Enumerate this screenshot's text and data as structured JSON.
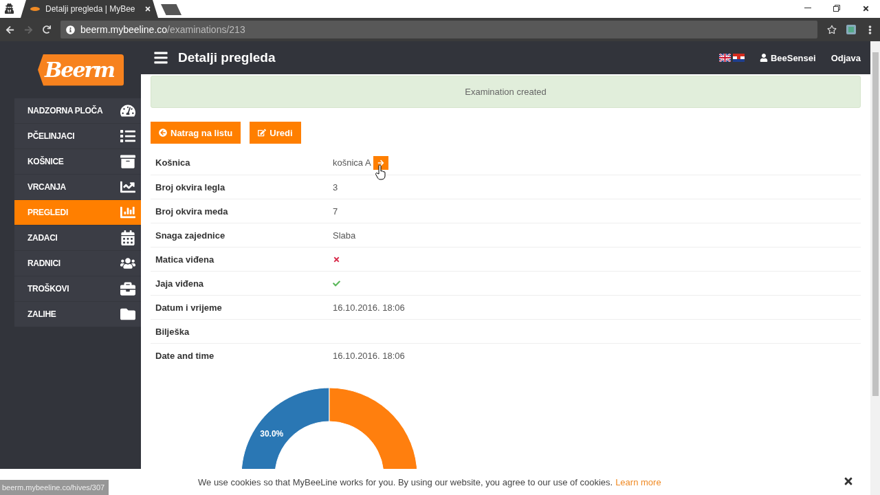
{
  "browser": {
    "tab_title": "Detalji pregleda | MyBee",
    "url_host": "beerm.mybeeline.co",
    "url_path": "/examinations/213",
    "status_url": "beerm.mybeeline.co/hives/307"
  },
  "logo": "Beerm",
  "sidebar": {
    "items": [
      {
        "label": "NADZORNA PLOČA",
        "selected": false
      },
      {
        "label": "PČELINJACI",
        "selected": false
      },
      {
        "label": "KOŠNICE",
        "selected": false
      },
      {
        "label": "VRCANJA",
        "selected": false
      },
      {
        "label": "PREGLEDI",
        "selected": true
      },
      {
        "label": "ZADACI",
        "selected": false
      },
      {
        "label": "RADNICI",
        "selected": false
      },
      {
        "label": "TROŠKOVI",
        "selected": false
      },
      {
        "label": "ZALIHE",
        "selected": false
      }
    ]
  },
  "header": {
    "title": "Detalji pregleda",
    "user": "BeeSensei",
    "logout": "Odjava"
  },
  "alert": "Examination created",
  "buttons": [
    "Natrag na listu",
    "Uredi"
  ],
  "details": [
    {
      "label": "Košnica",
      "kind": "link",
      "value": "košnica A"
    },
    {
      "label": "Broj okvira legla",
      "kind": "text",
      "value": "3"
    },
    {
      "label": "Broj okvira meda",
      "kind": "text",
      "value": "7"
    },
    {
      "label": "Snaga zajednice",
      "kind": "text",
      "value": "Slaba"
    },
    {
      "label": "Matica viđena",
      "kind": "check",
      "checked": false
    },
    {
      "label": "Jaja viđena",
      "kind": "check",
      "checked": true
    },
    {
      "label": "Datum i vrijeme",
      "kind": "text",
      "value": "16.10.2016. 18:06"
    },
    {
      "label": "Bilješka",
      "kind": "text"
    },
    {
      "label": "Date and time",
      "kind": "text",
      "value": "16.10.2016. 18:06"
    }
  ],
  "chart_data": {
    "type": "donut",
    "values": [
      30,
      70
    ],
    "colors": [
      "#2a77b4",
      "#ff7f0e"
    ],
    "value_labels": [
      "30.0%",
      null
    ]
  },
  "cookie": {
    "text": "We use cookies so that MyBeeLine works for you. By using our website, you agree to our use of cookies.",
    "link": "Learn more"
  }
}
